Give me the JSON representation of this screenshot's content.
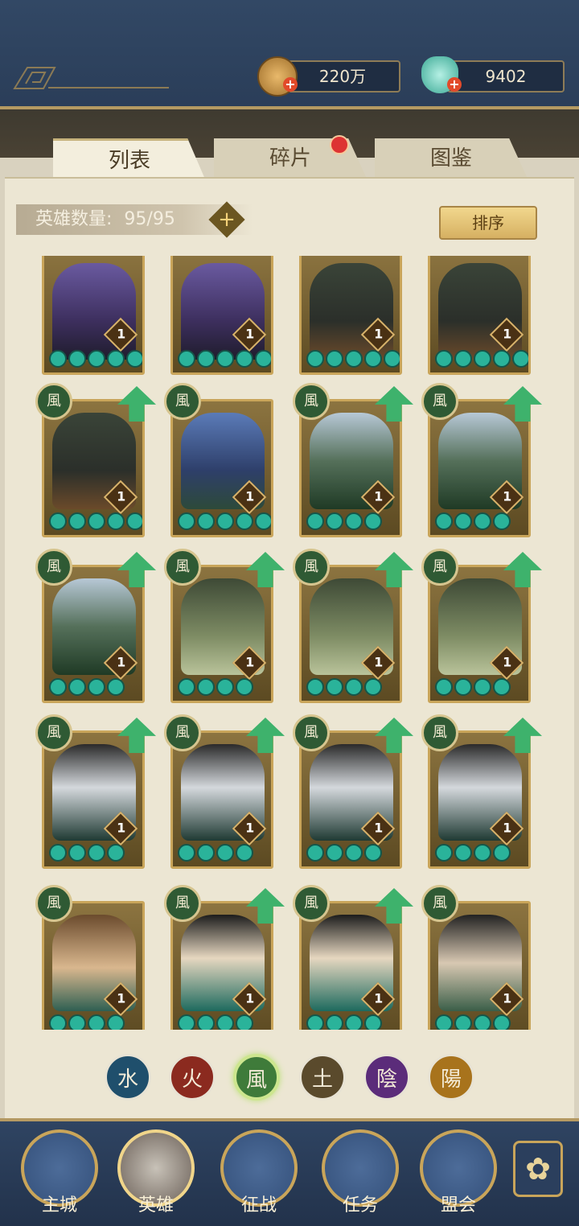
{
  "resources": {
    "coins": "220万",
    "jade": "9402"
  },
  "tabs": [
    {
      "label": "列表",
      "active": true
    },
    {
      "label": "碎片",
      "active": false,
      "badge": true
    },
    {
      "label": "图鉴",
      "active": false
    }
  ],
  "hero_count": {
    "label": "英雄数量:",
    "value": "95/95"
  },
  "sort_label": "排序",
  "hero_rows": [
    [
      {
        "level": "1",
        "stars": 5,
        "element": "",
        "upgrade": false,
        "portrait": "purple-hair-girl"
      },
      {
        "level": "1",
        "stars": 5,
        "element": "",
        "upgrade": false,
        "portrait": "purple-hair-girl"
      },
      {
        "level": "1",
        "stars": 5,
        "element": "",
        "upgrade": false,
        "portrait": "dark-hair-archer"
      },
      {
        "level": "1",
        "stars": 5,
        "element": "",
        "upgrade": false,
        "portrait": "dark-hair-archer"
      }
    ],
    [
      {
        "level": "1",
        "stars": 5,
        "element": "風",
        "upgrade": true,
        "portrait": "dark-hair-archer"
      },
      {
        "level": "1",
        "stars": 5,
        "element": "風",
        "upgrade": false,
        "portrait": "blue-hair-scholar"
      },
      {
        "level": "1",
        "stars": 4,
        "element": "風",
        "upgrade": true,
        "portrait": "silver-hair-general"
      },
      {
        "level": "1",
        "stars": 4,
        "element": "風",
        "upgrade": true,
        "portrait": "silver-hair-general"
      }
    ],
    [
      {
        "level": "1",
        "stars": 4,
        "element": "風",
        "upgrade": true,
        "portrait": "silver-hair-general"
      },
      {
        "level": "1",
        "stars": 4,
        "element": "風",
        "upgrade": true,
        "portrait": "green-hair-lady"
      },
      {
        "level": "1",
        "stars": 4,
        "element": "風",
        "upgrade": true,
        "portrait": "green-hair-lady"
      },
      {
        "level": "1",
        "stars": 4,
        "element": "風",
        "upgrade": true,
        "portrait": "green-hair-lady"
      }
    ],
    [
      {
        "level": "1",
        "stars": 4,
        "element": "風",
        "upgrade": true,
        "portrait": "masked-assassin"
      },
      {
        "level": "1",
        "stars": 4,
        "element": "風",
        "upgrade": true,
        "portrait": "masked-assassin"
      },
      {
        "level": "1",
        "stars": 4,
        "element": "風",
        "upgrade": true,
        "portrait": "masked-assassin"
      },
      {
        "level": "1",
        "stars": 4,
        "element": "風",
        "upgrade": true,
        "portrait": "masked-assassin"
      }
    ],
    [
      {
        "level": "1",
        "stars": 4,
        "element": "風",
        "upgrade": false,
        "portrait": "brown-hair-lady"
      },
      {
        "level": "1",
        "stars": 4,
        "element": "風",
        "upgrade": true,
        "portrait": "long-hair-swordsman"
      },
      {
        "level": "1",
        "stars": 4,
        "element": "風",
        "upgrade": true,
        "portrait": "long-hair-swordsman"
      },
      {
        "level": "1",
        "stars": 4,
        "element": "風",
        "upgrade": false,
        "portrait": "short-hair-lady"
      }
    ]
  ],
  "element_filters": [
    {
      "label": "水",
      "color": "#1f4f6c",
      "selected": false
    },
    {
      "label": "火",
      "color": "#8b2a1f",
      "selected": false
    },
    {
      "label": "風",
      "color": "#3f7b3a",
      "selected": true
    },
    {
      "label": "土",
      "color": "#5a4a2c",
      "selected": false
    },
    {
      "label": "陰",
      "color": "#5b2c7a",
      "selected": false
    },
    {
      "label": "陽",
      "color": "#a8731c",
      "selected": false
    }
  ],
  "nav": [
    {
      "label": "主城",
      "icon": "palace-icon"
    },
    {
      "label": "英雄",
      "icon": "hero-portrait-icon"
    },
    {
      "label": "征战",
      "icon": "war-drum-icon"
    },
    {
      "label": "任务",
      "icon": "scroll-icon"
    },
    {
      "label": "盟会",
      "icon": "pavilion-icon"
    }
  ],
  "colors": {
    "card_border": "#c9a55a",
    "star": "#2ab39a",
    "upgrade_arrow": "#3eb26c",
    "element_badge": "#2f5a34"
  }
}
